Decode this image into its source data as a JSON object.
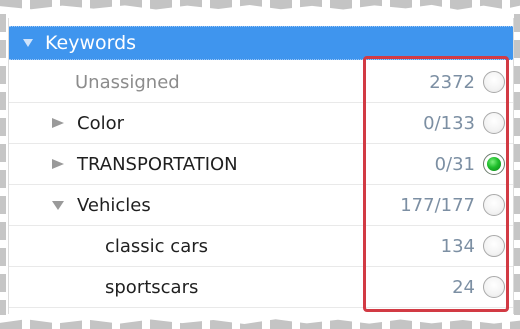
{
  "header": {
    "title": "Keywords",
    "expanded_icon": "triangle-down-icon"
  },
  "rows": [
    {
      "label": "Unassigned",
      "count": "2372",
      "indent": 0,
      "toggle": "none",
      "muted": true,
      "selected": false
    },
    {
      "label": "Color",
      "count": "0/133",
      "indent": 1,
      "toggle": "collapsed",
      "muted": false,
      "selected": false
    },
    {
      "label": "TRANSPORTATION",
      "count": "0/31",
      "indent": 1,
      "toggle": "collapsed",
      "muted": false,
      "selected": true
    },
    {
      "label": "Vehicles",
      "count": "177/177",
      "indent": 1,
      "toggle": "expanded",
      "muted": false,
      "selected": false
    },
    {
      "label": "classic cars",
      "count": "134",
      "indent": 2,
      "toggle": "none",
      "muted": false,
      "selected": false
    },
    {
      "label": "sportscars",
      "count": "24",
      "indent": 2,
      "toggle": "none",
      "muted": false,
      "selected": false
    }
  ],
  "colors": {
    "header_bg": "#3f95ee",
    "highlight": "#d23a44",
    "count_text": "#7c8fa3",
    "selected_radio": "#1fbf2c"
  }
}
